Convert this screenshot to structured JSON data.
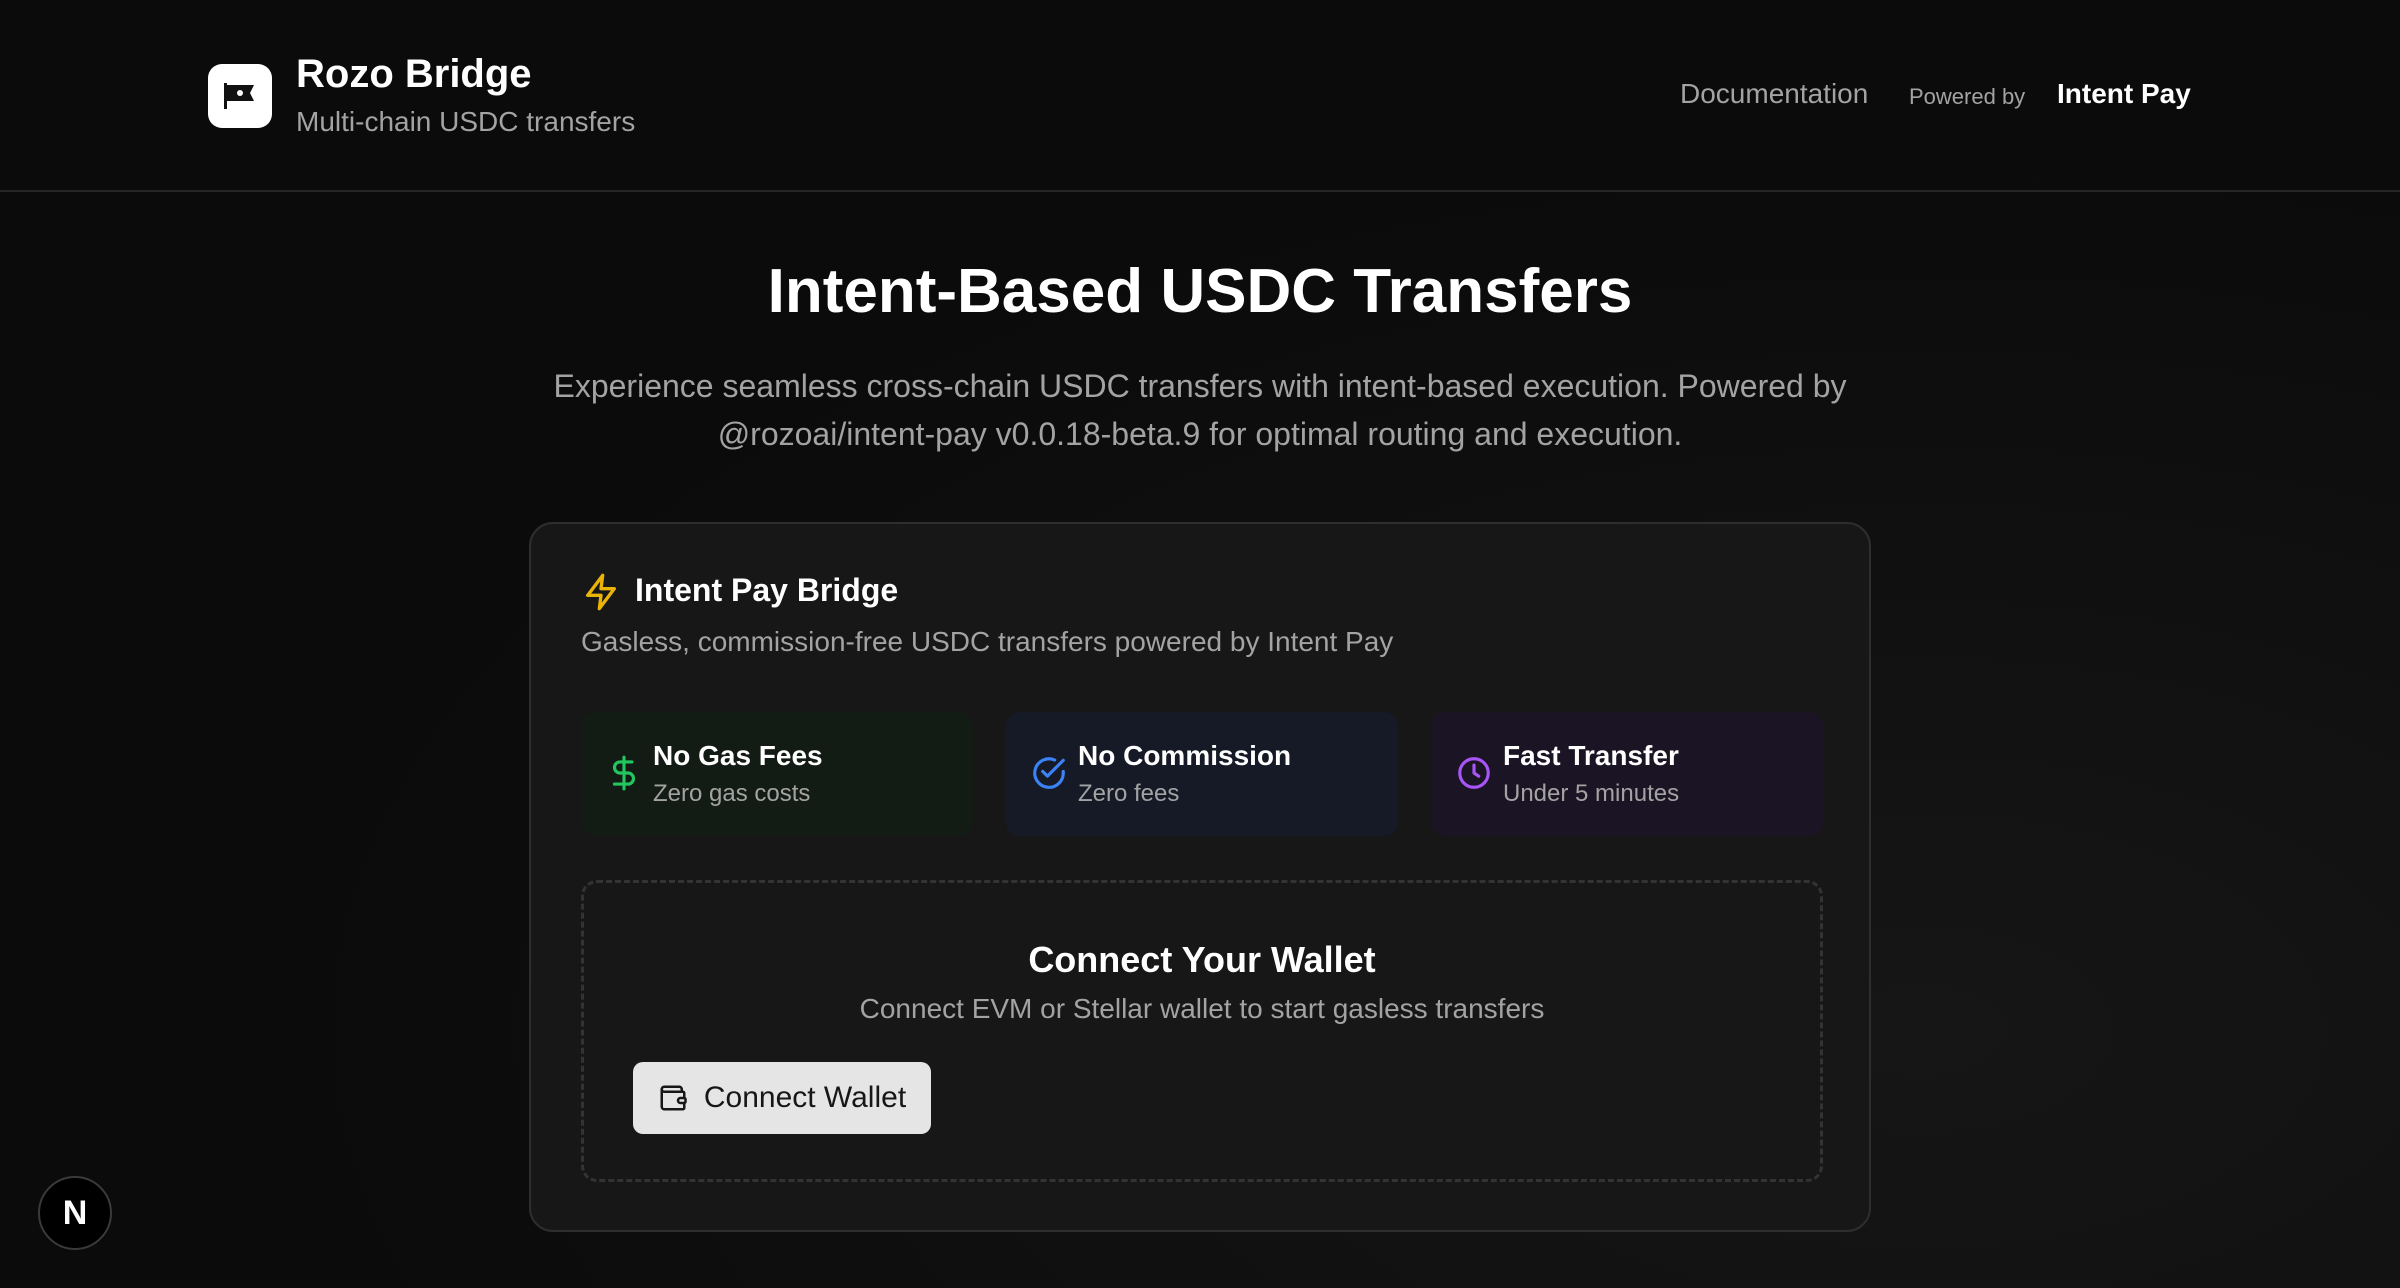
{
  "header": {
    "brand_title": "Rozo Bridge",
    "brand_subtitle": "Multi-chain USDC transfers",
    "nav_documentation": "Documentation",
    "powered_label": "Powered by",
    "powered_brand": "Intent Pay"
  },
  "hero": {
    "title": "Intent-Based USDC Transfers",
    "description_line1": "Experience seamless cross-chain USDC transfers with intent-based execution. Powered by",
    "description_line2": "@rozoai/intent-pay v0.0.18-beta.9 for optimal routing and execution."
  },
  "card": {
    "icon": "lightning-icon",
    "title": "Intent Pay Bridge",
    "subtitle": "Gasless, commission-free USDC transfers powered by Intent Pay",
    "features": [
      {
        "icon": "dollar-icon",
        "title": "No Gas Fees",
        "subtitle": "Zero gas costs",
        "accent": "#22c55e"
      },
      {
        "icon": "check-circle-icon",
        "title": "No Commission",
        "subtitle": "Zero fees",
        "accent": "#3b82f6"
      },
      {
        "icon": "clock-icon",
        "title": "Fast Transfer",
        "subtitle": "Under 5 minutes",
        "accent": "#a855f7"
      }
    ],
    "connect": {
      "title": "Connect Your Wallet",
      "subtitle": "Connect EVM or Stellar wallet to start gasless transfers",
      "button_label": "Connect Wallet",
      "button_icon": "wallet-icon"
    }
  },
  "floating_badge": "N",
  "colors": {
    "background": "#0b0b0b",
    "card": "#171717",
    "accent_yellow": "#eab308",
    "accent_green": "#22c55e",
    "accent_blue": "#3b82f6",
    "accent_purple": "#a855f7"
  }
}
